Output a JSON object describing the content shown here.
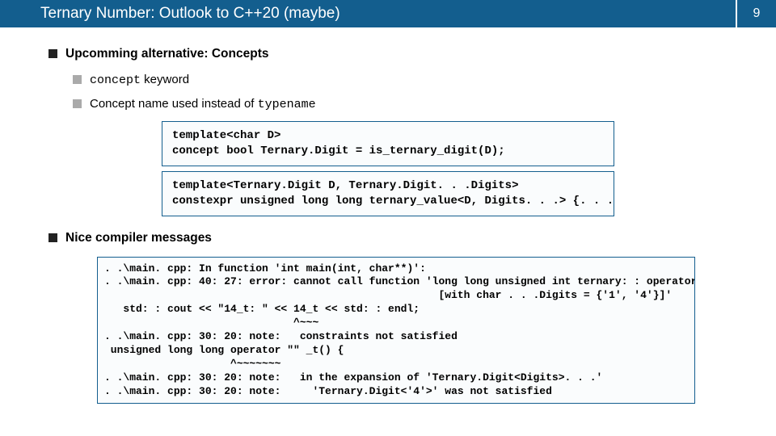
{
  "header": {
    "title": "Ternary Number: Outlook to C++20 (maybe)",
    "page_number": "9"
  },
  "bullets": {
    "heading1": "Upcomming alternative: Concepts",
    "sub1_pre": "concept",
    "sub1_post": " keyword",
    "sub2_pre": "Concept name used instead of ",
    "sub2_mono": "typename",
    "heading2": "Nice compiler messages"
  },
  "code": {
    "block1": "template<char D>\nconcept bool Ternary.Digit = is_ternary_digit(D);",
    "block2": "template<Ternary.Digit D, Ternary.Digit. . .Digits>\nconstexpr unsigned long long ternary_value<D, Digits. . .> {. . .};"
  },
  "compiler_msg": ". .\\main. cpp: In function 'int main(int, char**)':\n. .\\main. cpp: 40: 27: error: cannot call function 'long long unsigned int ternary: : operator\"\"_t()\n                                                     [with char . . .Digits = {'1', '4'}]'\n   std: : cout << \"14_t: \" << 14_t << std: : endl;\n                              ^~~~\n. .\\main. cpp: 30: 20: note:   constraints not satisfied\n unsigned long long operator \"\" _t() {\n                    ^~~~~~~~\n. .\\main. cpp: 30: 20: note:   in the expansion of 'Ternary.Digit<Digits>. . .'\n. .\\main. cpp: 30: 20: note:     'Ternary.Digit<'4'>' was not satisfied"
}
